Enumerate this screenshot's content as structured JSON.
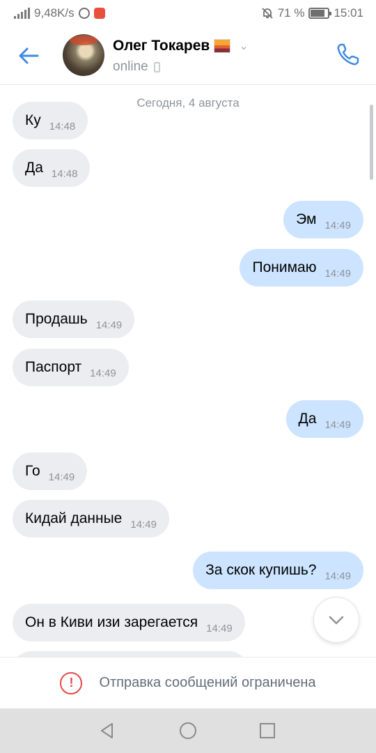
{
  "status_bar": {
    "speed": "9,48K/s",
    "battery": "71 %",
    "time": "15:01"
  },
  "header": {
    "contact_name": "Олег Токарев",
    "status": "online"
  },
  "chat": {
    "date_separator": "Сегодня, 4 августа",
    "messages": [
      {
        "text": "Ку",
        "time": "14:48",
        "dir": "in"
      },
      {
        "text": "Да",
        "time": "14:48",
        "dir": "in"
      },
      {
        "text": "Эм",
        "time": "14:49",
        "dir": "out"
      },
      {
        "text": "Понимаю",
        "time": "14:49",
        "dir": "out"
      },
      {
        "text": "Продашь",
        "time": "14:49",
        "dir": "in"
      },
      {
        "text": "Паспорт",
        "time": "14:49",
        "dir": "in"
      },
      {
        "text": "Да",
        "time": "14:49",
        "dir": "out"
      },
      {
        "text": "Го",
        "time": "14:49",
        "dir": "in"
      },
      {
        "text": "Кидай данные",
        "time": "14:49",
        "dir": "in"
      },
      {
        "text": "За скок купишь?",
        "time": "14:49",
        "dir": "out"
      },
      {
        "text": "Он в Киви изи зарегается",
        "time": "14:49",
        "dir": "in"
      }
    ]
  },
  "restriction": {
    "text": "Отправка сообщений ограничена"
  },
  "colors": {
    "accent": "#3f8ae0",
    "incoming_bubble": "#ebedf0",
    "outgoing_bubble": "#cce4ff",
    "warning": "#e64646"
  },
  "icons": {
    "back": "arrow-left-icon",
    "call": "phone-icon",
    "scroll_down": "chevron-down-icon",
    "warning": "exclamation-circle-icon",
    "nav_back": "triangle-back-icon",
    "nav_home": "circle-home-icon",
    "nav_recent": "square-recent-icon"
  }
}
